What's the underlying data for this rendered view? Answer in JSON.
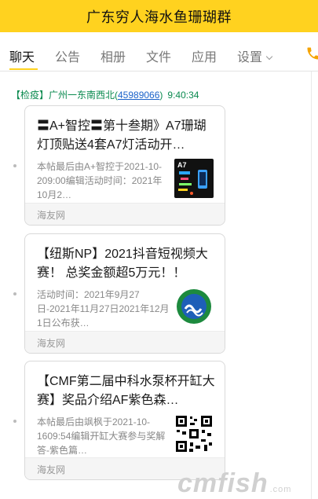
{
  "header": {
    "title": "广东穷人海水鱼珊瑚群"
  },
  "tabs": [
    {
      "label": "聊天"
    },
    {
      "label": "公告"
    },
    {
      "label": "相册"
    },
    {
      "label": "文件"
    },
    {
      "label": "应用"
    },
    {
      "label": "设置"
    }
  ],
  "message": {
    "sender_prefix": "【检疫】广州一东南西北(",
    "sender_id": "45989066",
    "sender_suffix": ")",
    "time": "9:40:34"
  },
  "cards": [
    {
      "title": "〓A+智控〓第十叁期》A7珊瑚灯顶贴送4套A7灯活动开…",
      "desc": "本帖最后由A+智控于2021-10-209:00编辑活动时间：2021年10月2…",
      "source": "海友网",
      "thumb_icon": "a7-lamp-thumbnail"
    },
    {
      "title": "【纽斯NP】2021抖音短视频大赛！ 总奖金额超5万元！！",
      "desc": "活动时间：2021年9月27日-2021年11月27日2021年12月1日公布获…",
      "source": "海友网",
      "thumb_icon": "newsnp-logo"
    },
    {
      "title": "【CMF第二届中科水泵杯开缸大赛】奖品介绍AF紫色森…",
      "desc": "本帖最后由飒枫于2021-10-1609:54编辑开缸大赛参与奖解答-紫色篇…",
      "source": "海友网",
      "thumb_icon": "qr-code"
    }
  ],
  "watermark": {
    "text": "cmfish",
    "sub": ".com"
  },
  "colors": {
    "header_bg": "#ffd21f",
    "meta_green": "#0a8a4f",
    "link_blue": "#1a62c9"
  }
}
